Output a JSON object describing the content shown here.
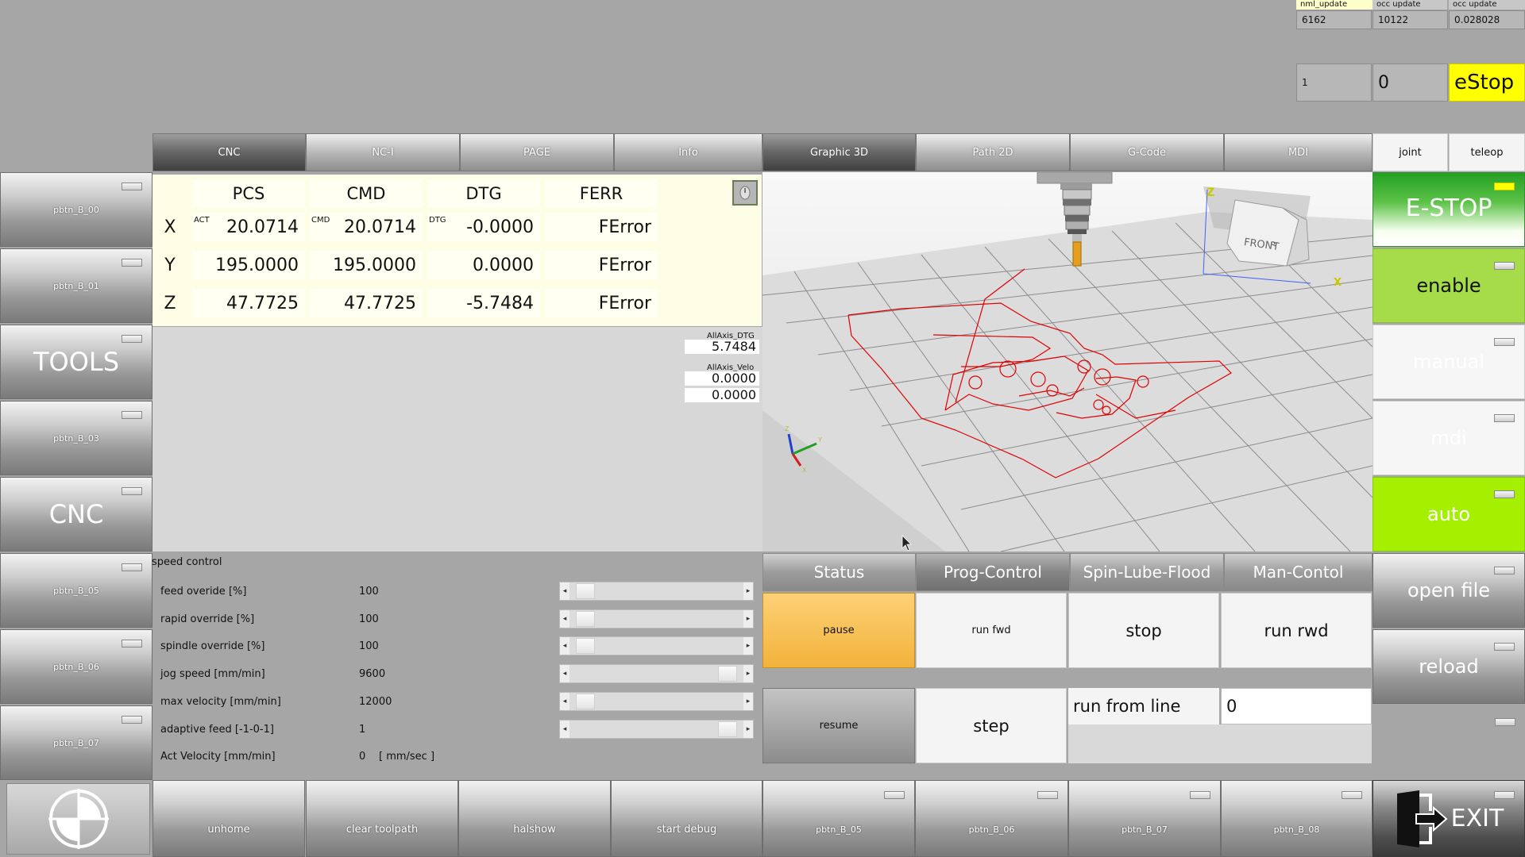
{
  "info": {
    "headers": [
      "nml_update",
      "occ update",
      "occ update"
    ],
    "values": [
      "6162",
      "10122",
      "0.028028"
    ],
    "field_a": "1",
    "field_b": "0",
    "estop_label": "eStop"
  },
  "tabs": [
    "CNC",
    "NC-I",
    "PAGE",
    "Info",
    "Graphic 3D",
    "Path 2D",
    "G-Code",
    "MDI"
  ],
  "mode_tabs": [
    "joint",
    "teleop"
  ],
  "left_buttons": [
    "pbtn_B_00",
    "pbtn_B_01",
    "TOOLS",
    "pbtn_B_03",
    "CNC",
    "pbtn_B_05",
    "pbtn_B_06",
    "pbtn_B_07"
  ],
  "dro": {
    "headers": [
      "PCS",
      "CMD",
      "DTG",
      "FERR"
    ],
    "tags": [
      "ACT",
      "CMD",
      "DTG"
    ],
    "rows": [
      {
        "axis": "X",
        "pcs": "20.0714",
        "cmd": "20.0714",
        "dtg": "-0.0000",
        "ferr": "FError"
      },
      {
        "axis": "Y",
        "pcs": "195.0000",
        "cmd": "195.0000",
        "dtg": "0.0000",
        "ferr": "FError"
      },
      {
        "axis": "Z",
        "pcs": "47.7725",
        "cmd": "47.7725",
        "dtg": "-5.7484",
        "ferr": "FError"
      }
    ],
    "allaxis_dtg_label": "AllAxis_DTG",
    "allaxis_dtg": "5.7484",
    "allaxis_velo_label": "AllAxis_Velo",
    "allaxis_velo_1": "0.0000",
    "allaxis_velo_2": "0.0000"
  },
  "speed_control": {
    "title": "speed control",
    "rows": [
      {
        "label": "feed overide [%]",
        "value": "100",
        "level": 0.04
      },
      {
        "label": "rapid override [%]",
        "value": "100",
        "level": 0.04
      },
      {
        "label": "spindle override [%]",
        "value": "100",
        "level": 0.04
      },
      {
        "label": "jog speed [mm/min]",
        "value": "9600",
        "level": 0.96
      },
      {
        "label": "max velocity [mm/min]",
        "value": "12000",
        "level": 0.04
      },
      {
        "label": "adaptive feed [-1-0-1]",
        "value": "1",
        "level": 0.96
      }
    ],
    "act_velocity_label": "Act Velocity [mm/min]",
    "act_velocity_value": "0",
    "act_velocity_unit": "[ mm/sec ]"
  },
  "viewport": {
    "cube_label": "FRONT",
    "axis_z": "Z",
    "axis_x": "X"
  },
  "prog_tabs": [
    "Status",
    "Prog-Control",
    "Spin-Lube-Flood",
    "Man-Contol"
  ],
  "prog": {
    "pause": "pause",
    "run_fwd": "run fwd",
    "stop": "stop",
    "run_rwd": "run rwd",
    "resume": "resume",
    "step": "step",
    "run_from_line": "run from line",
    "run_from_line_value": "0"
  },
  "right_buttons": [
    "E-STOP",
    "enable",
    "manual",
    "mdi",
    "auto",
    "open file",
    "reload"
  ],
  "bottom_buttons": [
    "unhome",
    "clear toolpath",
    "halshow",
    "start debug",
    "pbtn_B_05",
    "pbtn_B_06",
    "pbtn_B_07",
    "pbtn_B_08"
  ],
  "exit_label": "EXIT",
  "colors": {
    "estop_yellow": "#ffff00",
    "enable_green": "#a6dc4a",
    "auto_green": "#a4f000",
    "pause_orange": "#f8bc4a",
    "dro_bg": "#fefee6",
    "toolpath_red": "#e00000"
  }
}
